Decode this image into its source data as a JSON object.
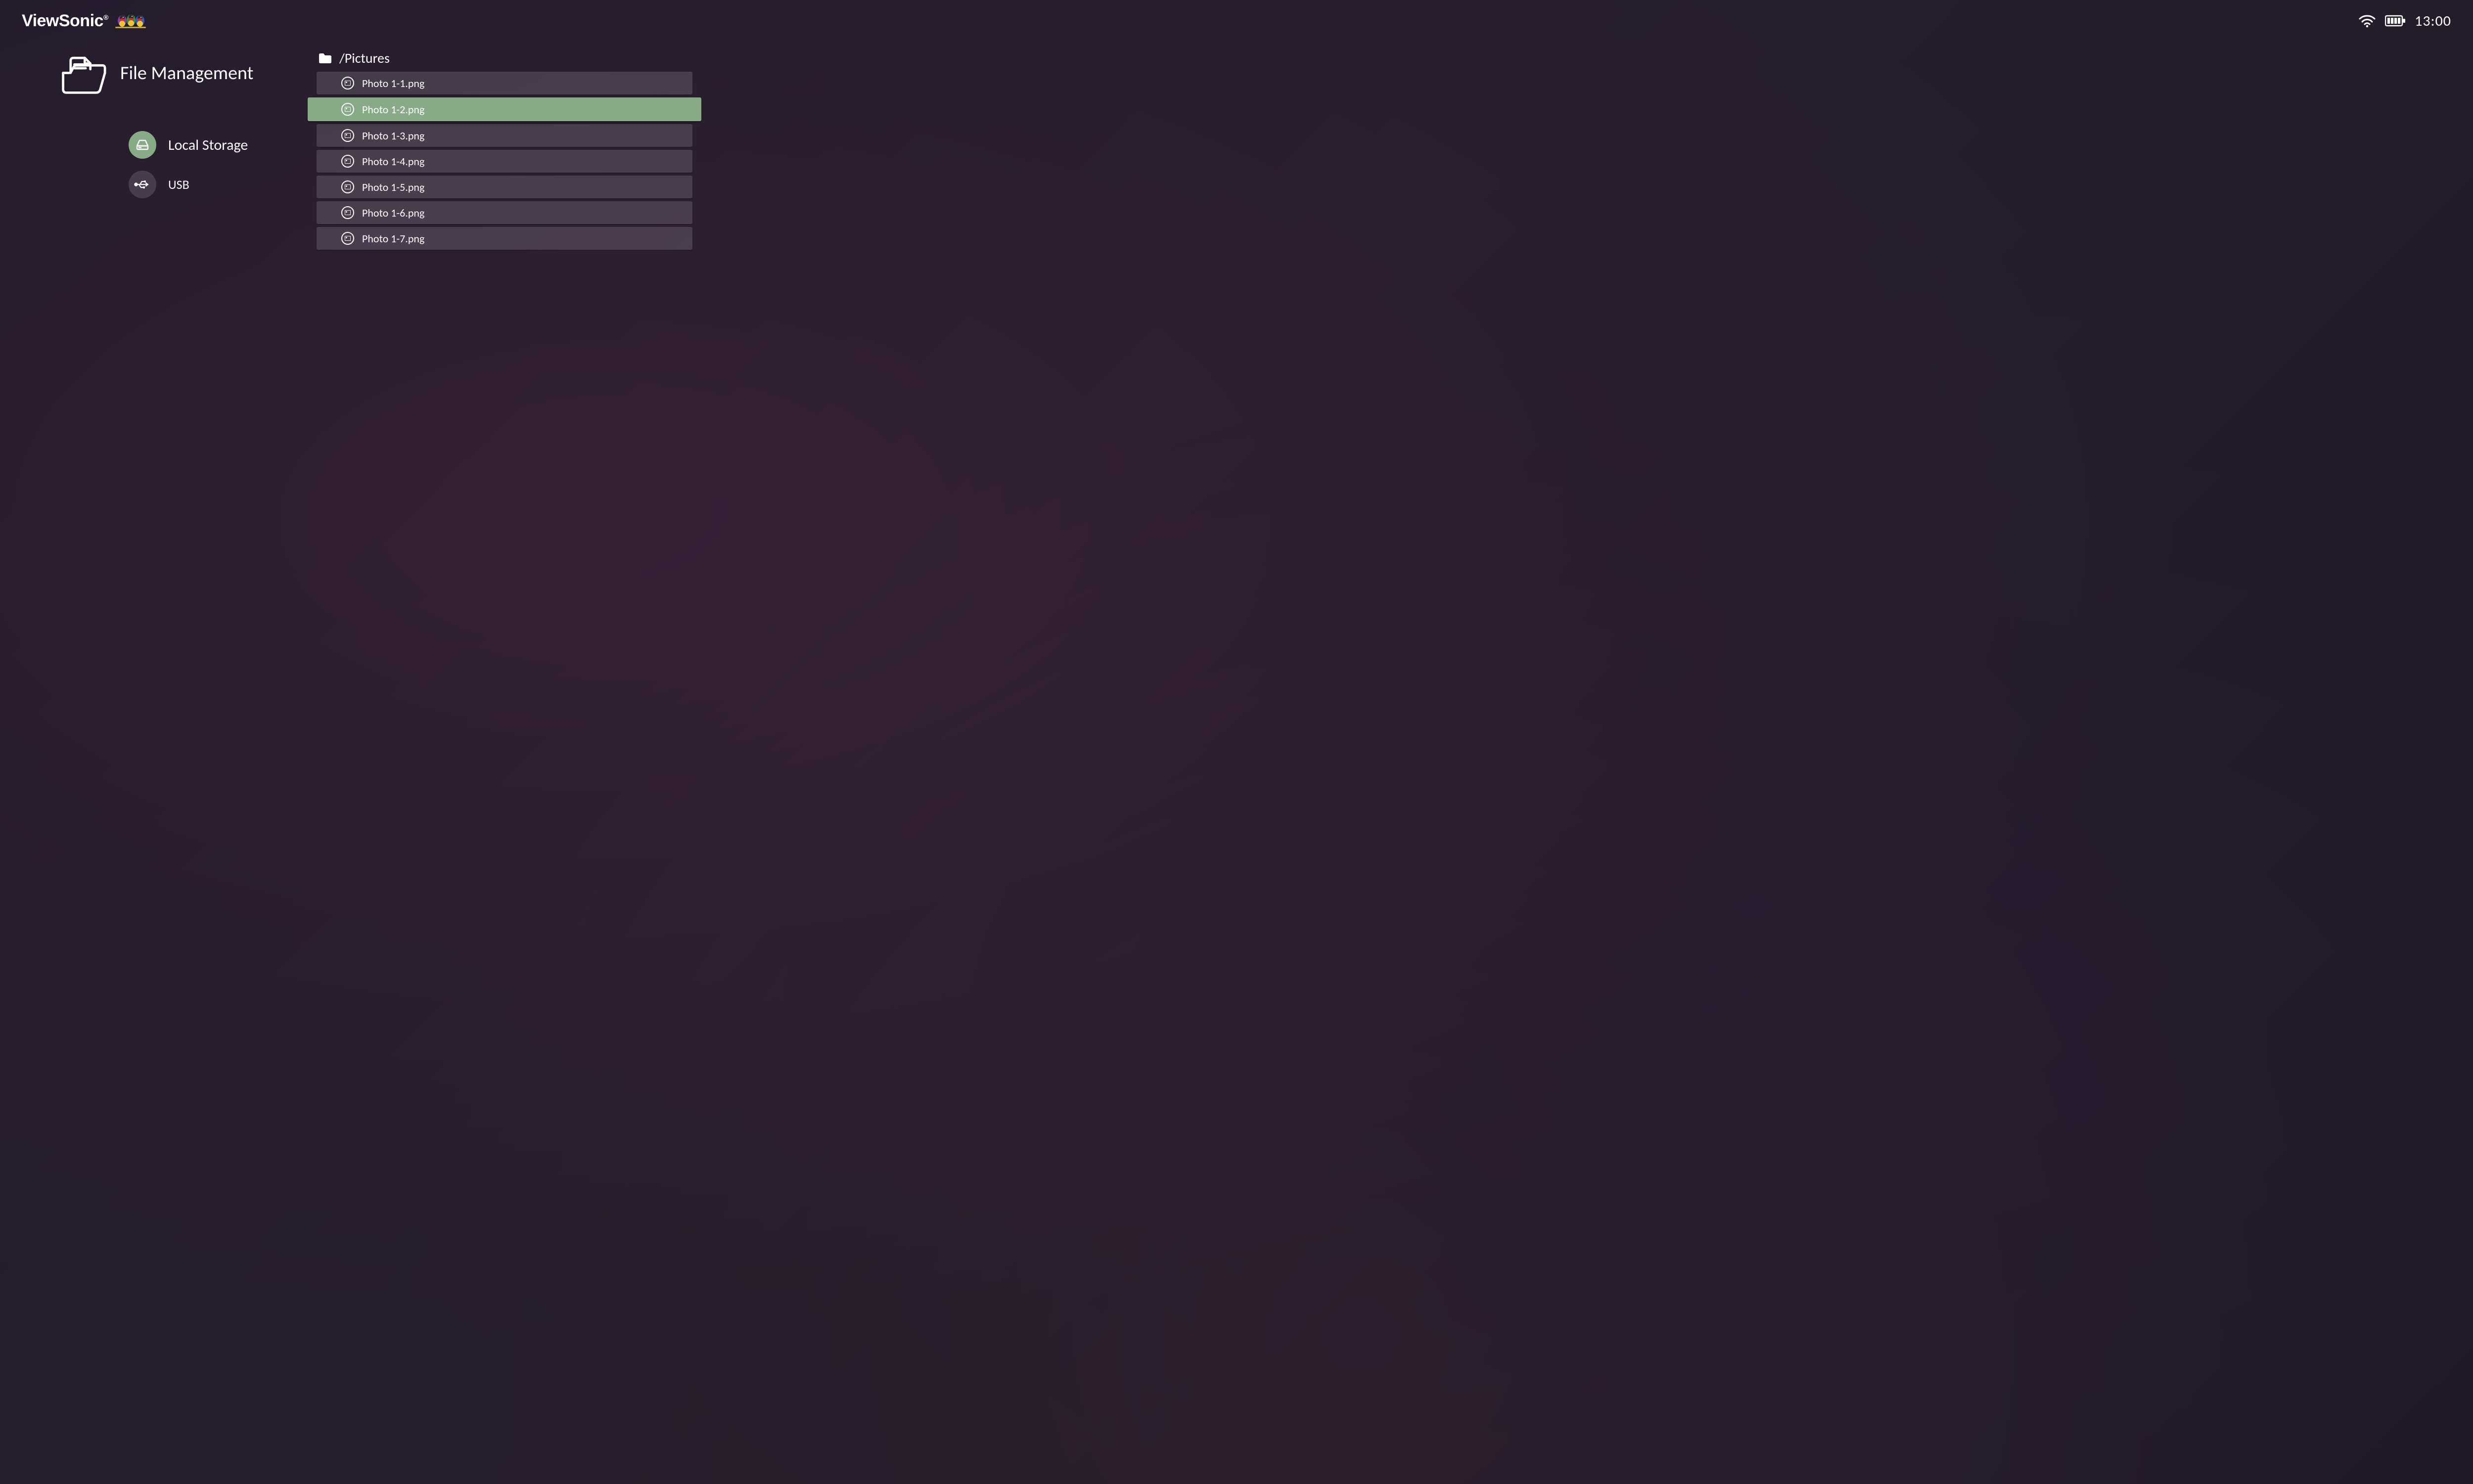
{
  "header": {
    "brand": "ViewSonic",
    "clock": "13:00"
  },
  "page": {
    "title": "File Management"
  },
  "sources": [
    {
      "id": "local",
      "label": "Local Storage",
      "active": true
    },
    {
      "id": "usb",
      "label": "USB",
      "active": false
    }
  ],
  "browser": {
    "path": "/Pictures",
    "selected_index": 1,
    "files": [
      "Photo 1-1.png",
      "Photo 1-2.png",
      "Photo 1-3.png",
      "Photo 1-4.png",
      "Photo 1-5.png",
      "Photo 1-6.png",
      "Photo 1-7.png"
    ]
  },
  "colors": {
    "accent": "#86ab85",
    "row_bg": "rgba(255,255,255,0.14)"
  }
}
